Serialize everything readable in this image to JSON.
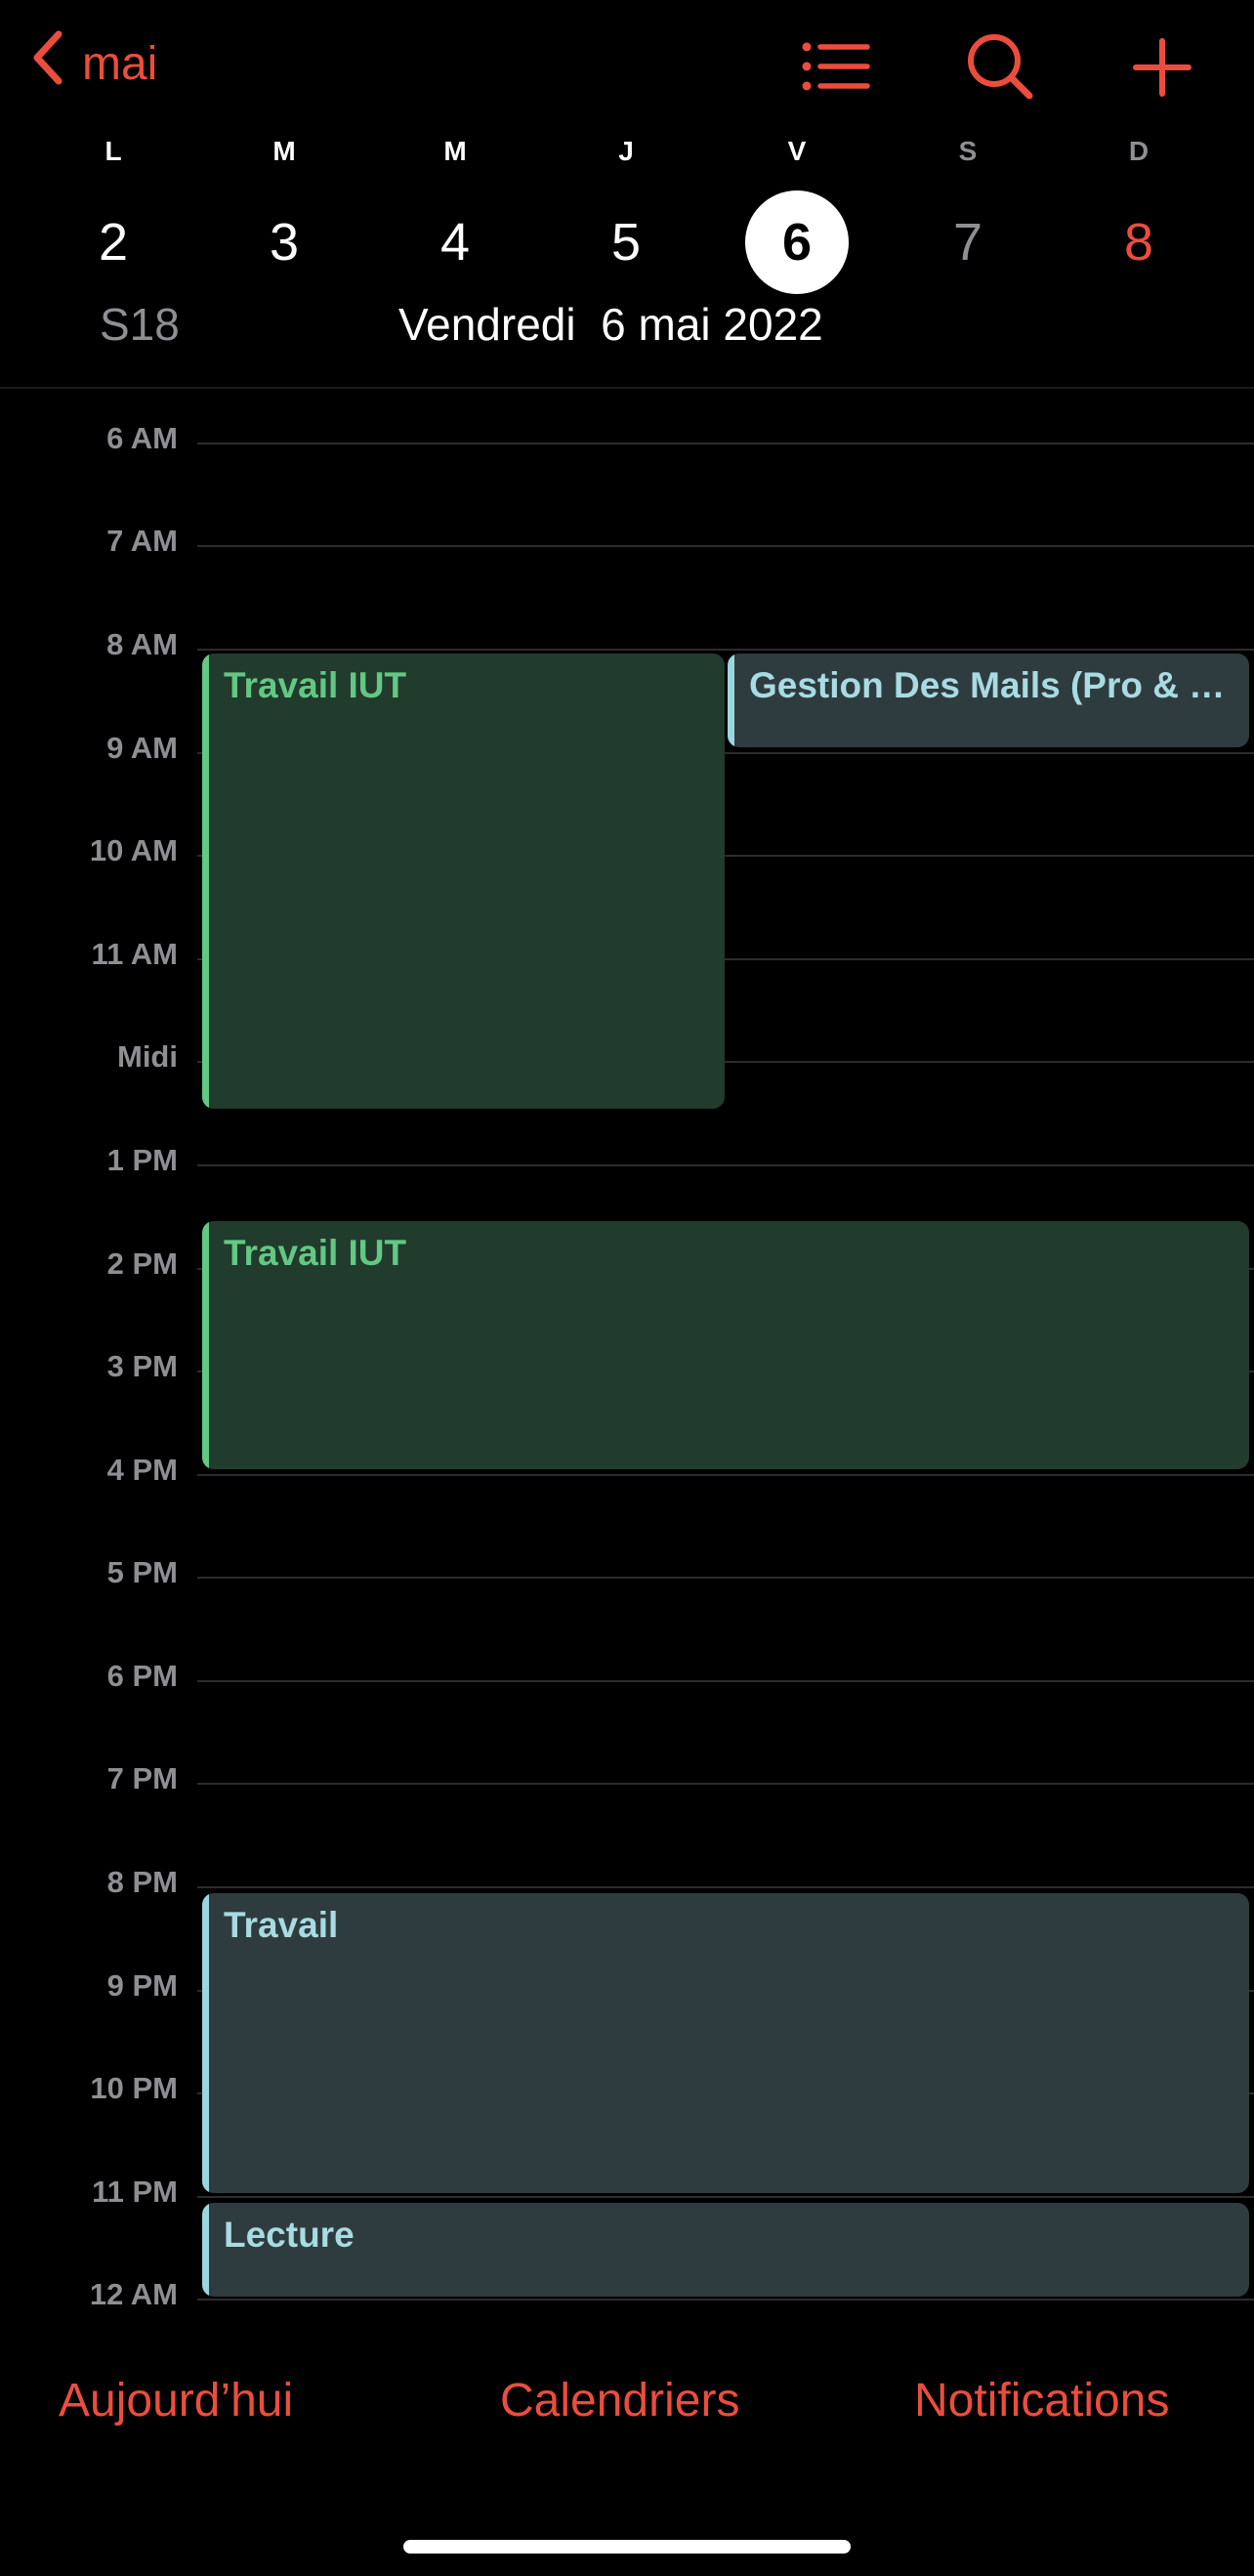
{
  "nav": {
    "back_label": "mai",
    "accent_color": "#eb4d3d"
  },
  "week": {
    "days": [
      {
        "letter": "L",
        "number": "2"
      },
      {
        "letter": "M",
        "number": "3"
      },
      {
        "letter": "M",
        "number": "4"
      },
      {
        "letter": "J",
        "number": "5"
      },
      {
        "letter": "V",
        "number": "6",
        "selected": true
      },
      {
        "letter": "S",
        "number": "7"
      },
      {
        "letter": "D",
        "number": "8"
      }
    ],
    "week_number": "S18",
    "selected_date": "Vendredi  6 mai 2022"
  },
  "timeline": {
    "hours": [
      "6 AM",
      "7 AM",
      "8 AM",
      "9 AM",
      "10 AM",
      "11 AM",
      "Midi",
      "1 PM",
      "2 PM",
      "3 PM",
      "4 PM",
      "5 PM",
      "6 PM",
      "7 PM",
      "8 PM",
      "9 PM",
      "10 PM",
      "11 PM",
      "12 AM"
    ],
    "events": [
      {
        "title": "Travail IUT",
        "calendar_color": "#63c883"
      },
      {
        "title": "Gestion Des Mails (Pro & Perso)",
        "calendar_color": "#9ad6dd"
      },
      {
        "title": "Travail IUT",
        "calendar_color": "#63c883"
      },
      {
        "title": "Travail",
        "calendar_color": "#9ad6dd"
      },
      {
        "title": "Lecture",
        "calendar_color": "#9ad6dd"
      }
    ]
  },
  "toolbar": {
    "today_label": "Aujourd’hui",
    "calendars_label": "Calendriers",
    "notifications_label": "Notifications"
  }
}
